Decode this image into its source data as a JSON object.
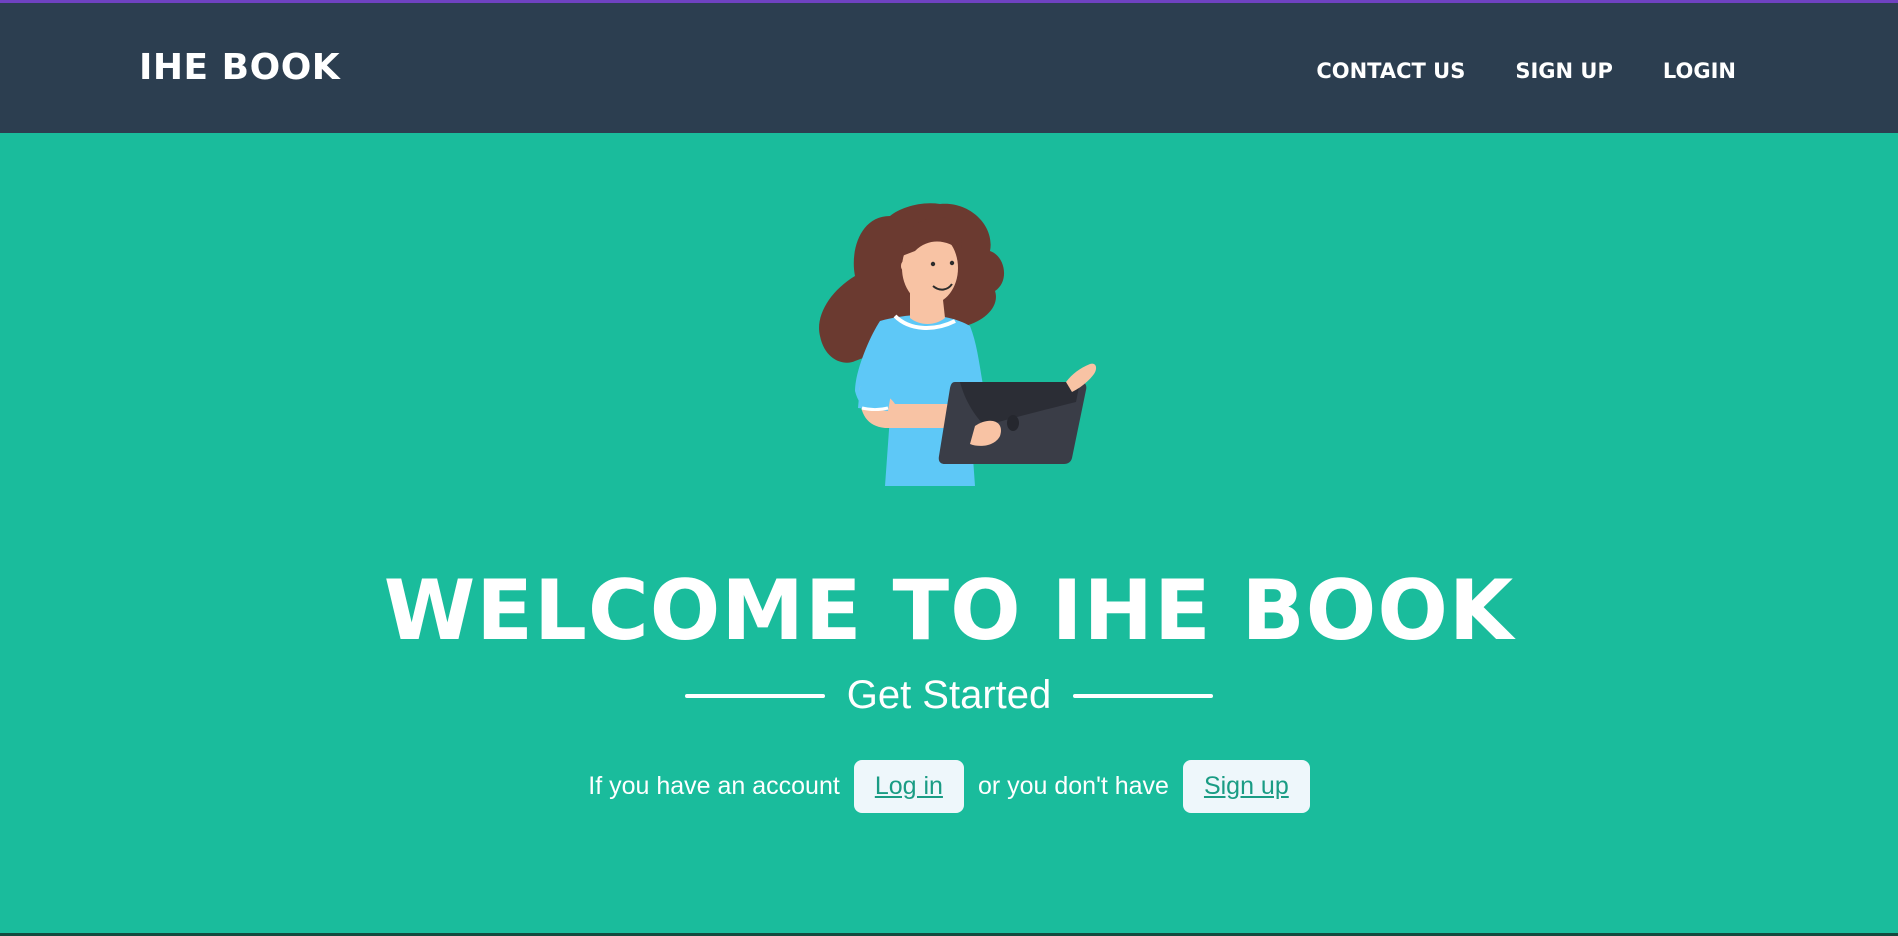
{
  "nav": {
    "brand": "IHE BOOK",
    "links": [
      {
        "label": "CONTACT US"
      },
      {
        "label": "SIGN UP"
      },
      {
        "label": "LOGIN"
      }
    ]
  },
  "hero": {
    "illustration": "woman-with-laptop",
    "title": "WELCOME TO IHE BOOK",
    "subtitle": "Get Started",
    "cta": {
      "text_before": "If you have an account",
      "login_label": "Log in",
      "text_middle": "or you don't have",
      "signup_label": "Sign up"
    }
  },
  "colors": {
    "hero_bg": "#1abc9c",
    "navbar_bg": "#2c3e50",
    "accent_top": "#6f42c1",
    "button_bg": "#eef7fb",
    "button_text": "#1a9c84"
  }
}
